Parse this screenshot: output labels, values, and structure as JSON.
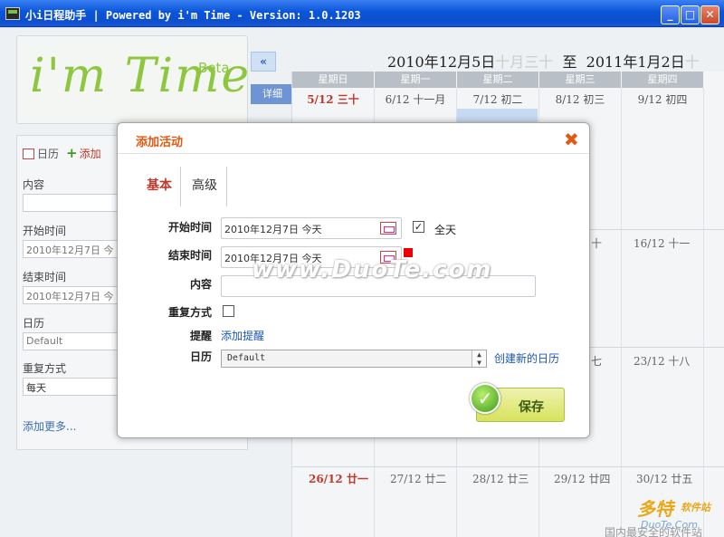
{
  "window": {
    "title": "小i日程助手 | Powered by i'm Time - Version: 1.0.1203",
    "min": "_",
    "max": "□",
    "close": "✕"
  },
  "logo": {
    "text": "i'm Time",
    "beta": "Beta"
  },
  "nav": {
    "collapse": "«",
    "detail": "详细"
  },
  "range": {
    "start": "2010年12月5日",
    "start_lunar": "十月三十",
    "sep": "至",
    "end": "2011年1月2日",
    "end_lunar": "十"
  },
  "calendar": {
    "days": [
      "星期日",
      "星期一",
      "星期二",
      "星期三",
      "星期四"
    ],
    "week1": [
      "5/12 三十",
      "6/12 十一月",
      "7/12 初二",
      "8/12 初三",
      "9/12 初四"
    ],
    "week2_partial": [
      "十",
      "16/12 十一"
    ],
    "week3_partial": [
      "七",
      "23/12 十八"
    ],
    "week4": [
      "26/12 廿一",
      "27/12 廿二",
      "28/12 廿三",
      "29/12 廿四",
      "30/12 廿五"
    ]
  },
  "side": {
    "tab_calendar": "日历",
    "tab_add": "添加",
    "content_label": "内容",
    "start_label": "开始时间",
    "start_value": "2010年12月7日 今",
    "end_label": "结束时间",
    "end_value": "2010年12月7日 今",
    "calendar_label": "日历",
    "calendar_value": "Default",
    "repeat_label": "重复方式",
    "repeat_value": "每天",
    "more": "添加更多..."
  },
  "dialog": {
    "title": "添加活动",
    "close": "✖",
    "tab_basic": "基本",
    "tab_advanced": "高级",
    "start_label": "开始时间",
    "start_value": "2010年12月7日  今天",
    "allday_label": "全天",
    "allday_checked": "✓",
    "end_label": "结束时间",
    "end_value": "2010年12月7日  今天",
    "content_label": "内容",
    "repeat_label": "重复方式",
    "remind_label": "提醒",
    "remind_link": "添加提醒",
    "calendar_label": "日历",
    "calendar_value": "Default",
    "new_calendar_link": "创建新的日历",
    "save": "保存",
    "save_icon": "✓"
  },
  "watermark": {
    "site": "www.DuoTe.com",
    "brand": "多特",
    "brand_sub": "软件站",
    "domain": "DuoTe.Com",
    "tagline": "国内最安全的软件站"
  }
}
